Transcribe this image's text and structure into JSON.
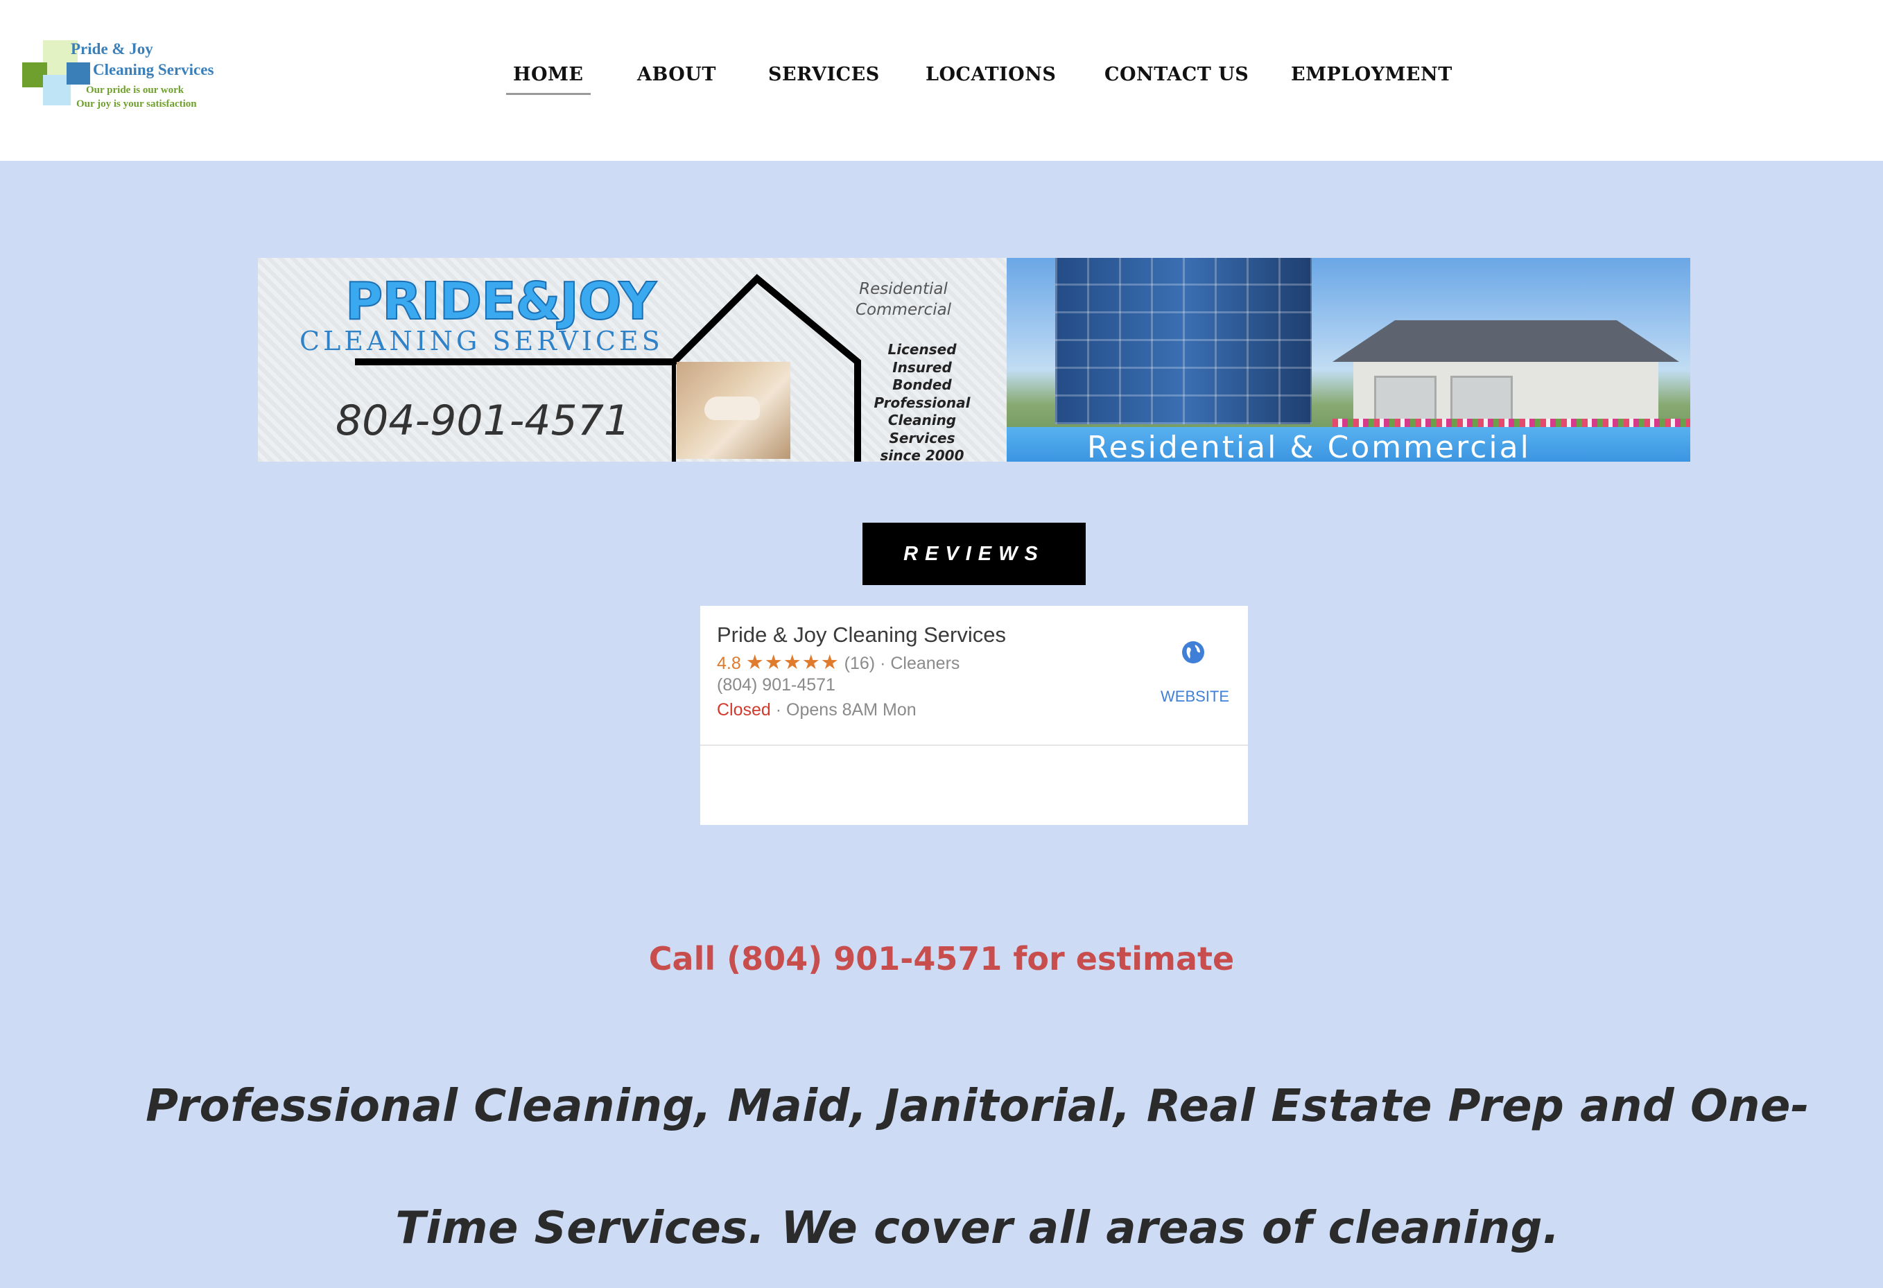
{
  "logo": {
    "line1": "Pride & Joy",
    "line2": "Cleaning Services",
    "tagline1": "Our pride is our work",
    "tagline2": "Our joy is your satisfaction"
  },
  "nav": {
    "items": [
      {
        "label": "HOME",
        "active": true
      },
      {
        "label": "ABOUT"
      },
      {
        "label": "SERVICES"
      },
      {
        "label": "LOCATIONS"
      },
      {
        "label": "CONTACT US"
      },
      {
        "label": "EMPLOYMENT"
      }
    ]
  },
  "banner": {
    "brand_line1": "PRIDE&JOY",
    "brand_line2": "CLEANING SERVICES",
    "phone": "804-901-4571",
    "types": [
      "Residential",
      "Commercial"
    ],
    "credentials": [
      "Licensed",
      "Insured",
      "Bonded",
      "Professional",
      "Cleaning Services",
      "since 2000"
    ],
    "caption": "Residential & Commercial"
  },
  "reviews": {
    "button_label": "REVIEWS",
    "card": {
      "name": "Pride & Joy Cleaning Services",
      "rating": "4.8",
      "stars": "★★★★★",
      "count": "(16)",
      "category": "· Cleaners",
      "phone": "(804) 901-4571",
      "status": "Closed",
      "opens": "· Opens 8AM Mon",
      "website_label": "WEBSITE",
      "icon": "globe-icon"
    }
  },
  "cta": "Call (804) 901-4571 for estimate",
  "headline": "Professional Cleaning, Maid, Janitorial, Real Estate Prep and One-Time Services. We cover all areas of cleaning.",
  "colors": {
    "page_bg": "#cddcf4",
    "header_bg": "#ffffff",
    "cta": "#c84e4e",
    "star": "#e07b2e",
    "closed": "#d23a2e",
    "link": "#3f7fd8"
  }
}
